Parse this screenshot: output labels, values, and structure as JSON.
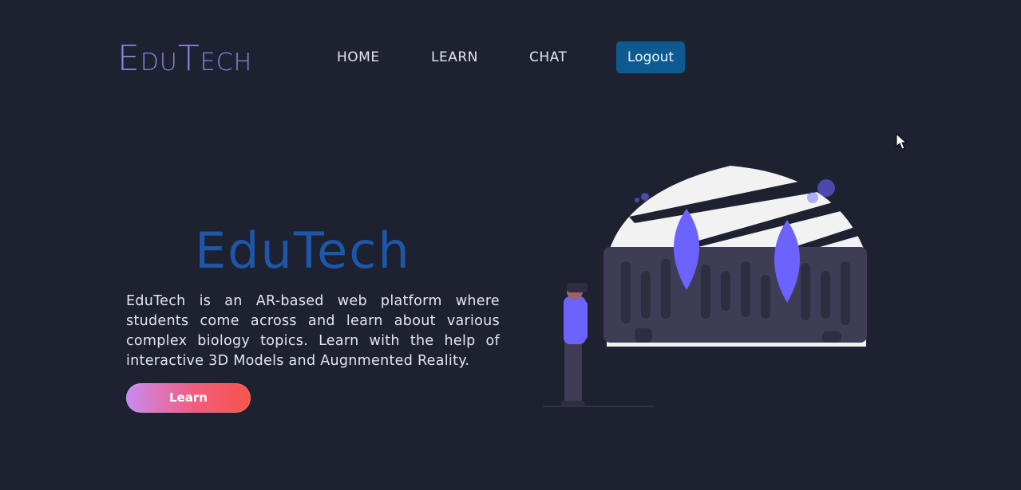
{
  "header": {
    "logo": {
      "parts": [
        {
          "text": "E",
          "size": "cap"
        },
        {
          "text": "DU",
          "size": "small"
        },
        {
          "text": "T",
          "size": "cap"
        },
        {
          "text": "ECH",
          "size": "small"
        }
      ]
    },
    "nav": {
      "home": "HOME",
      "learn": "LEARN",
      "chat": "CHAT"
    },
    "logout_label": "Logout"
  },
  "hero": {
    "title": "EduTech",
    "description": "EduTech is an AR-based web platform where students come across and learn about various complex biology topics. Learn with the help of interactive 3D Models and Augnmented Reality.",
    "cta_label": "Learn"
  },
  "illustration": {
    "icon": "vr-person-illustration",
    "colors": {
      "accent": "#6c63ff",
      "dome": "#f2f2f2",
      "base": "#3f3d56",
      "figure_legs": "#2f2e41"
    }
  },
  "colors": {
    "background": "#1d2130",
    "logo": "#8f84dc",
    "hero_title": "#1e56a8",
    "logout_button": "#0d5a91"
  }
}
